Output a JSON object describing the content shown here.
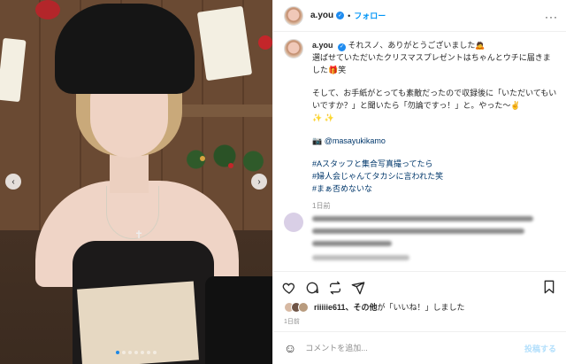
{
  "post": {
    "username": "a.you",
    "follow_label": "フォロー",
    "separator": "•",
    "more_icon": "more-horizontal-icon"
  },
  "caption": {
    "username": "a.you",
    "line1": "それスノ、ありがとうございました🙇",
    "line2": "選ばせていただいたクリスマスプレゼントはちゃんとウチに届きました🎁笑",
    "para2": "そして、お手紙がとっても素敵だったので収録後に「いただいてもいいですか？」と聞いたら「勿論ですっ！」と。やった〜✌️",
    "sparkles": "✨ ✨",
    "camera_emoji": "📷",
    "photo_credit": "@masayukikamo",
    "hashtags": [
      "#Aスタッフと集合写真撮ってたら",
      "#婦人会じゃんてタカシに言われた笑",
      "#まぁ否めないな"
    ],
    "time": "1日前"
  },
  "comment": {
    "time": "1日前"
  },
  "likes": {
    "user": "riiiiie611",
    "suffix": "、その他",
    "rest": "が「いいね！」しました"
  },
  "post_time": "1日前",
  "add_comment": {
    "placeholder": "コメントを追加...",
    "post_label": "投稿する"
  },
  "carousel": {
    "count": 7,
    "active": 0
  },
  "colors": {
    "link": "#00376b",
    "follow": "#0095f6",
    "verified": "#1f8cf0"
  }
}
